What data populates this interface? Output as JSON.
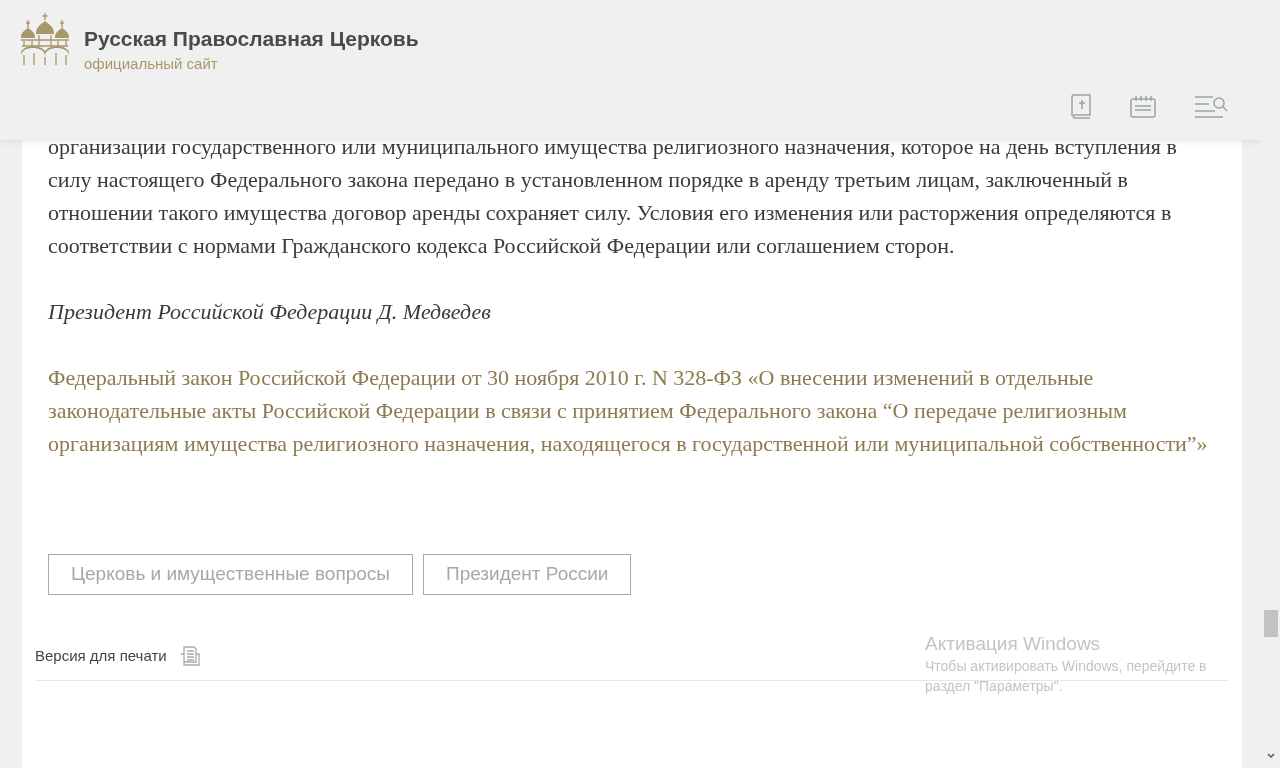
{
  "header": {
    "title": "Русская Православная Церковь",
    "subtitle": "официальный сайт"
  },
  "article": {
    "paragraphs": [
      {
        "kind": "body",
        "text": "организации государственного или муниципального имущества религиозного назначения, которое на день вступления в силу настоящего Федерального закона передано в установленном порядке в аренду третьим лицам, заключенный в отношении такого имущества договор аренды сохраняет силу. Условия его изменения или расторжения определяются в соответствии с нормами Гражданского кодекса Российской Федерации или соглашением сторон."
      },
      {
        "kind": "signature",
        "text": "Президент Российской Федерации Д. Медведев"
      },
      {
        "kind": "link",
        "text": "Федеральный закон Российской Федерации от 30 ноября 2010 г. N 328-ФЗ «О внесении изменений в отдельные законодательные акты Российской Федерации в связи с принятием Федерального закона “О передаче религиозным организациям имущества религиозного назначения, находящегося в государственной или муниципальной собственности”»"
      }
    ],
    "tags": [
      "Церковь и имущественные вопросы",
      "Президент России"
    ],
    "print_link": "Версия для печати"
  },
  "windows_notice": {
    "title": "Активация Windows",
    "text": "Чтобы активировать Windows, перейдите в раздел \"Параметры\"."
  }
}
